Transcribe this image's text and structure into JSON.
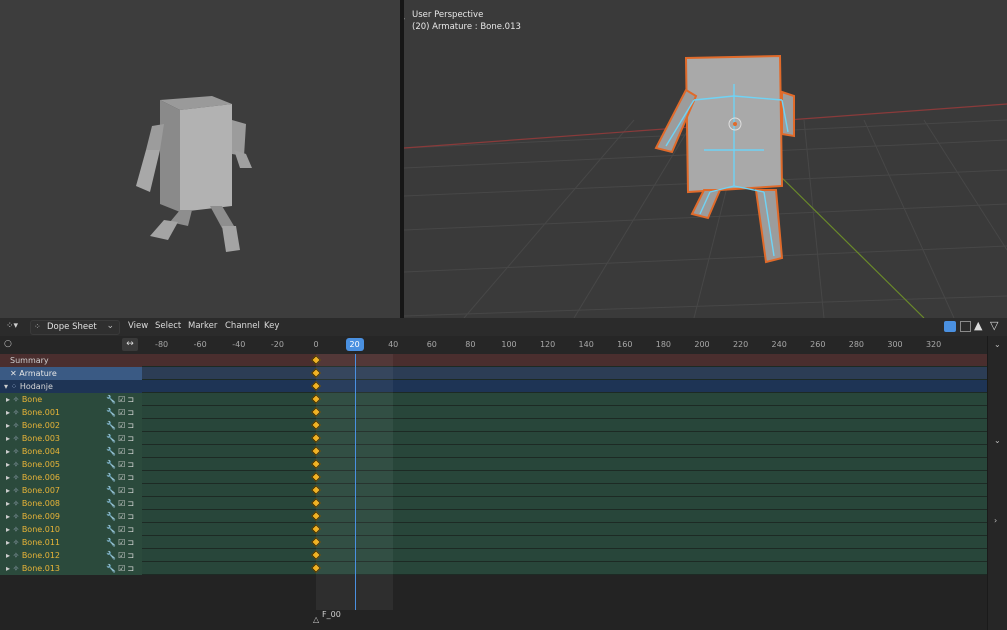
{
  "viewport": {
    "title": "User Perspective",
    "subtitle": "(20) Armature : Bone.013"
  },
  "dopesheet": {
    "editor_type": "Dope Sheet",
    "mode_icon": "dopesheet-icon",
    "menus": [
      "View",
      "Select",
      "Marker",
      "Channel",
      "Key"
    ],
    "current_frame": "20",
    "marker_label": "F_00",
    "ruler_ticks": [
      "-80",
      "-60",
      "-40",
      "-20",
      "0",
      "20",
      "40",
      "60",
      "80",
      "100",
      "120",
      "140",
      "160",
      "180",
      "200",
      "220",
      "240",
      "260",
      "280",
      "300",
      "320"
    ],
    "channels": {
      "summary": "Summary",
      "armature": "Armature",
      "action": "Hodanje",
      "bones": [
        "Bone",
        "Bone.001",
        "Bone.002",
        "Bone.003",
        "Bone.004",
        "Bone.005",
        "Bone.006",
        "Bone.007",
        "Bone.008",
        "Bone.009",
        "Bone.010",
        "Bone.011",
        "Bone.012",
        "Bone.013"
      ]
    },
    "keyframe_frame": 0,
    "colors": {
      "accent_blue": "#4a90e0",
      "keyframe": "#f0b020",
      "selection_orange": "#e06a2a",
      "bone_text": "#e8b438"
    }
  }
}
